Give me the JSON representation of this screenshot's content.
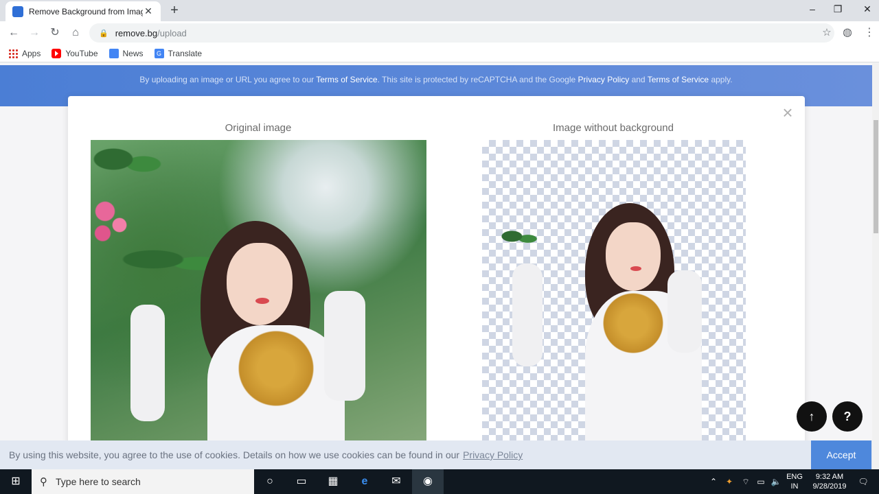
{
  "browser": {
    "tab_title": "Remove Background from Image",
    "url_host": "remove.bg",
    "url_path": "/upload",
    "window_min": "–",
    "window_max": "❐",
    "window_close": "✕",
    "new_tab": "+",
    "bookmarks": [
      {
        "label": "Apps",
        "icon": "apps-icon"
      },
      {
        "label": "YouTube",
        "icon": "youtube-icon"
      },
      {
        "label": "News",
        "icon": "news-icon"
      },
      {
        "label": "Translate",
        "icon": "translate-icon"
      }
    ]
  },
  "page": {
    "notice_prefix": "By uploading an image or URL you agree to our",
    "notice_tos": "Terms of Service",
    "notice_middle": ". This site is protected by reCAPTCHA and the Google",
    "notice_privacy": "Privacy Policy",
    "notice_and": "and",
    "notice_tos2": "Terms of Service",
    "notice_suffix": "apply.",
    "modal_close": "×",
    "original_title": "Original image",
    "result_title": "Image without background",
    "fab_up": "↑",
    "fab_help": "?"
  },
  "cookie": {
    "text": "By using this website, you agree to the use of cookies. Details on how we use cookies can be found in our",
    "link": "Privacy Policy",
    "accept": "Accept"
  },
  "taskbar": {
    "search_placeholder": "Type here to search",
    "lang_top": "ENG",
    "lang_bottom": "IN",
    "time": "9:32 AM",
    "date": "9/28/2019"
  },
  "colors": {
    "accent": "#4e88dc",
    "banner": "#5b86d8"
  }
}
